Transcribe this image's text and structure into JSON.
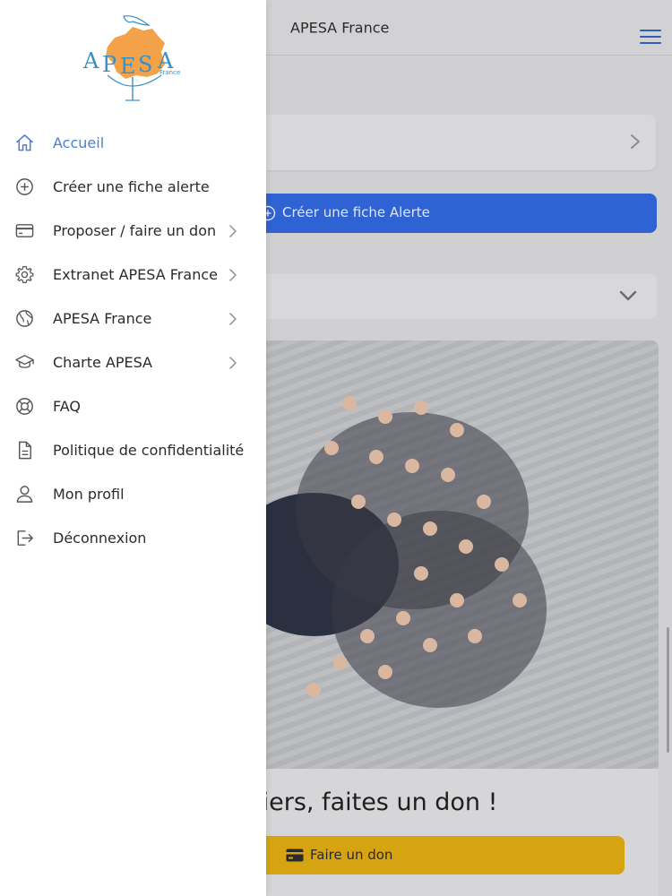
{
  "header": {
    "title": "APESA France"
  },
  "main": {
    "alert_button_label": "Créer une fiche Alerte",
    "donate_title": "uliers, faites un don !",
    "donate_button_label": "Faire un don"
  },
  "drawer": {
    "logo_text": "APESA",
    "logo_subtext": "France",
    "items": [
      {
        "label": "Accueil",
        "icon": "home-icon",
        "active": true,
        "has_chevron": false
      },
      {
        "label": "Créer une fiche alerte",
        "icon": "plus-circle-icon",
        "active": false,
        "has_chevron": false
      },
      {
        "label": "Proposer / faire un don",
        "icon": "credit-card-icon",
        "active": false,
        "has_chevron": true
      },
      {
        "label": "Extranet APESA France",
        "icon": "gear-icon",
        "active": false,
        "has_chevron": true
      },
      {
        "label": "APESA France",
        "icon": "globe-icon",
        "active": false,
        "has_chevron": true
      },
      {
        "label": "Charte APESA",
        "icon": "graduation-cap-icon",
        "active": false,
        "has_chevron": true
      },
      {
        "label": "FAQ",
        "icon": "help-buoy-icon",
        "active": false,
        "has_chevron": false
      },
      {
        "label": "Politique de confidentialité",
        "icon": "document-icon",
        "active": false,
        "has_chevron": false
      },
      {
        "label": "Mon profil",
        "icon": "person-icon",
        "active": false,
        "has_chevron": false
      },
      {
        "label": "Déconnexion",
        "icon": "logout-icon",
        "active": false,
        "has_chevron": false
      }
    ]
  },
  "colors": {
    "accent_blue": "#2f63d4",
    "active_item": "#4b7fd1",
    "donate_yellow": "#d6a410",
    "logo_orange": "#f4a24a",
    "logo_blue": "#3a8fc4"
  }
}
